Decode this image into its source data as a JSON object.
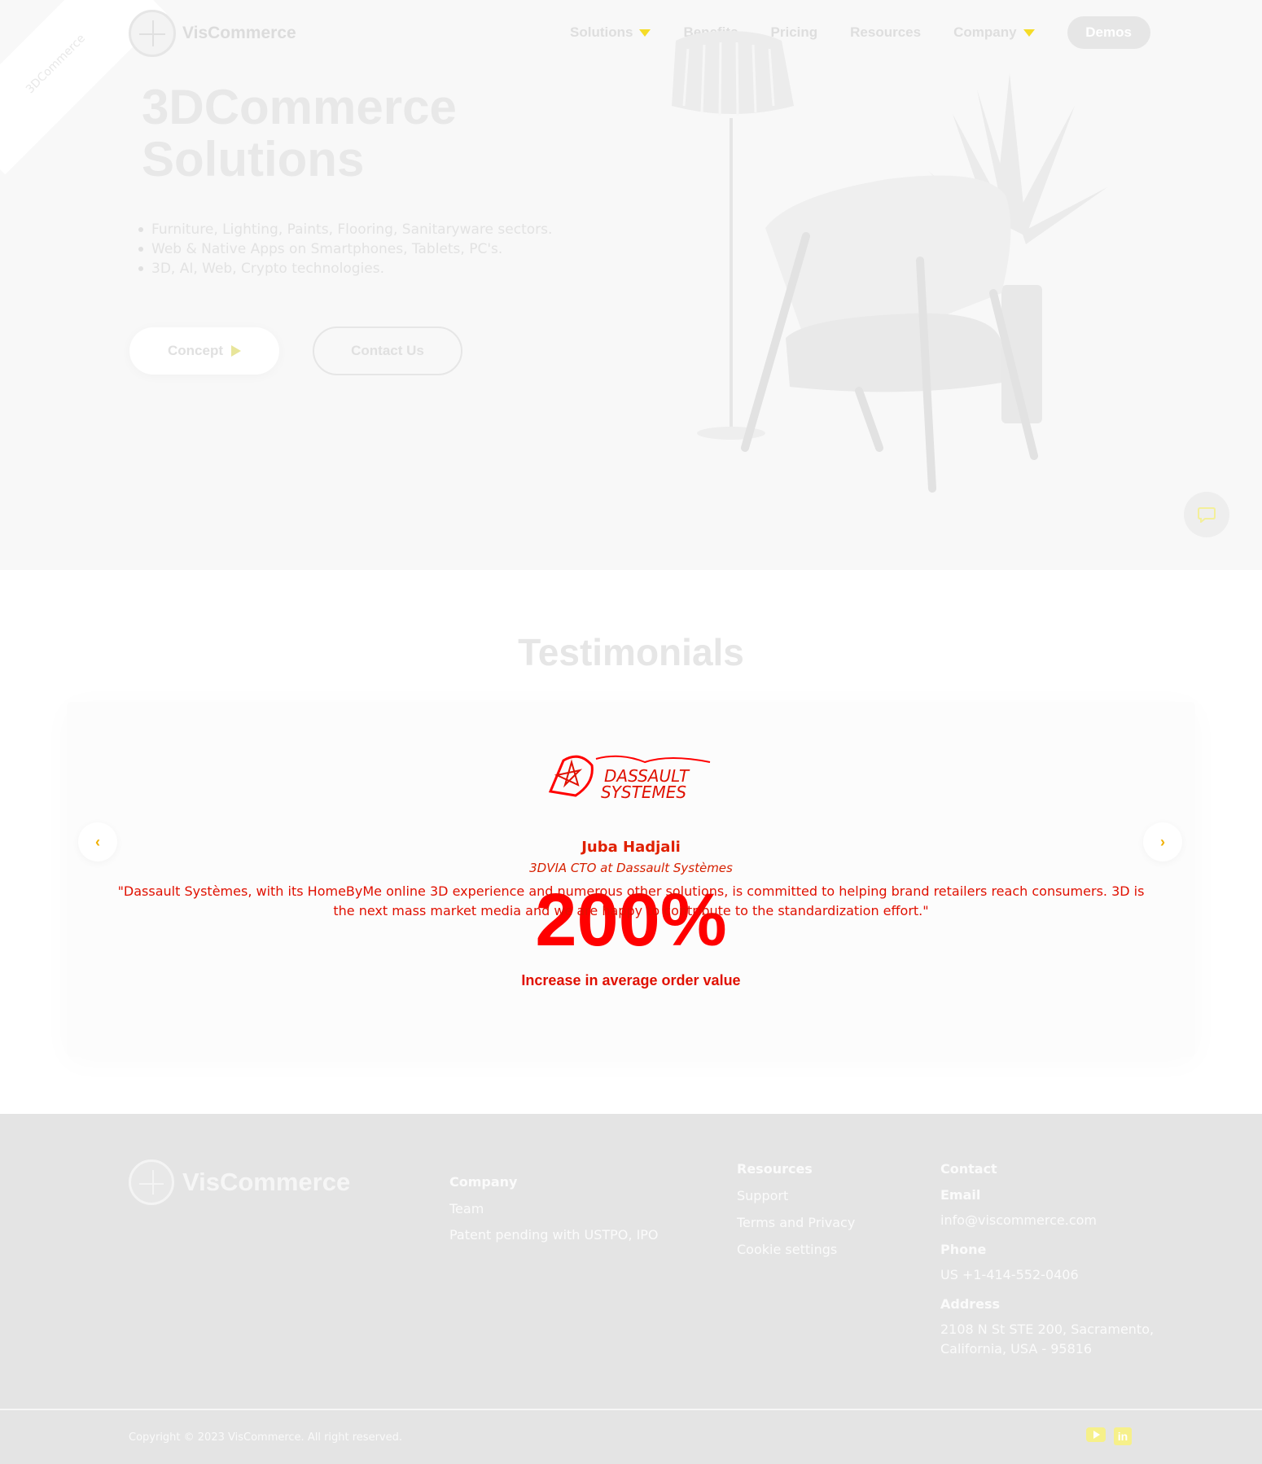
{
  "ribbon": {
    "text": "3DCommerce"
  },
  "header": {
    "logo_text": "VisCommerce",
    "nav": [
      {
        "label": "Solutions",
        "has_dropdown": true
      },
      {
        "label": "Benefits",
        "has_dropdown": false
      },
      {
        "label": "Pricing",
        "has_dropdown": false
      },
      {
        "label": "Resources",
        "has_dropdown": false
      },
      {
        "label": "Company",
        "has_dropdown": true
      }
    ],
    "demos_label": "Demos"
  },
  "hero": {
    "title_line1": "3DCommerce",
    "title_line2": "Solutions",
    "bullets": [
      "Furniture, Lighting, Paints, Flooring, Sanitaryware sectors.",
      "Web & Native Apps on Smartphones, Tablets, PC's.",
      "3D, AI, Web, Crypto technologies."
    ],
    "concept_label": "Concept",
    "contact_label": "Contact Us"
  },
  "testimonials": {
    "title": "Testimonials",
    "logo_alt": "DASSAULT SYSTEMES",
    "name": "Juba Hadjali",
    "role": "3DVIA CTO at Dassault Systèmes",
    "quote": "\"Dassault Systèmes, with its HomeByMe online 3D experience and numerous other solutions, is committed to helping brand retailers reach consumers. 3D is the next mass market media and we are happy to contribute to the standardization effort.\"",
    "stat_value": "200%",
    "stat_label": "Increase in average order value",
    "prev_label": "‹",
    "next_label": "›"
  },
  "footer": {
    "logo_text": "VisCommerce",
    "company": {
      "heading": "Company",
      "links": [
        "Team",
        "Patent pending with USTPO, IPO"
      ]
    },
    "resources": {
      "heading": "Resources",
      "links": [
        "Support",
        "Terms and Privacy",
        "Cookie settings"
      ]
    },
    "contact": {
      "heading": "Contact",
      "email_label": "Email",
      "email": "info@viscommerce.com",
      "phone_label": "Phone",
      "phone": "US +1-414-552-0406",
      "address_label": "Address",
      "address_line1": "2108 N St STE 200, Sacramento,",
      "address_line2": "California, USA - 95816"
    },
    "copyright": "Copyright © 2023 VisCommerce. All right reserved.",
    "social": [
      "youtube-icon",
      "linkedin-icon"
    ]
  },
  "colors": {
    "accent_yellow": "#f5dc28",
    "testimonial_red": "#ff0000",
    "footer_bg": "#e4e4e4",
    "hero_bg": "#f8f8f8"
  }
}
